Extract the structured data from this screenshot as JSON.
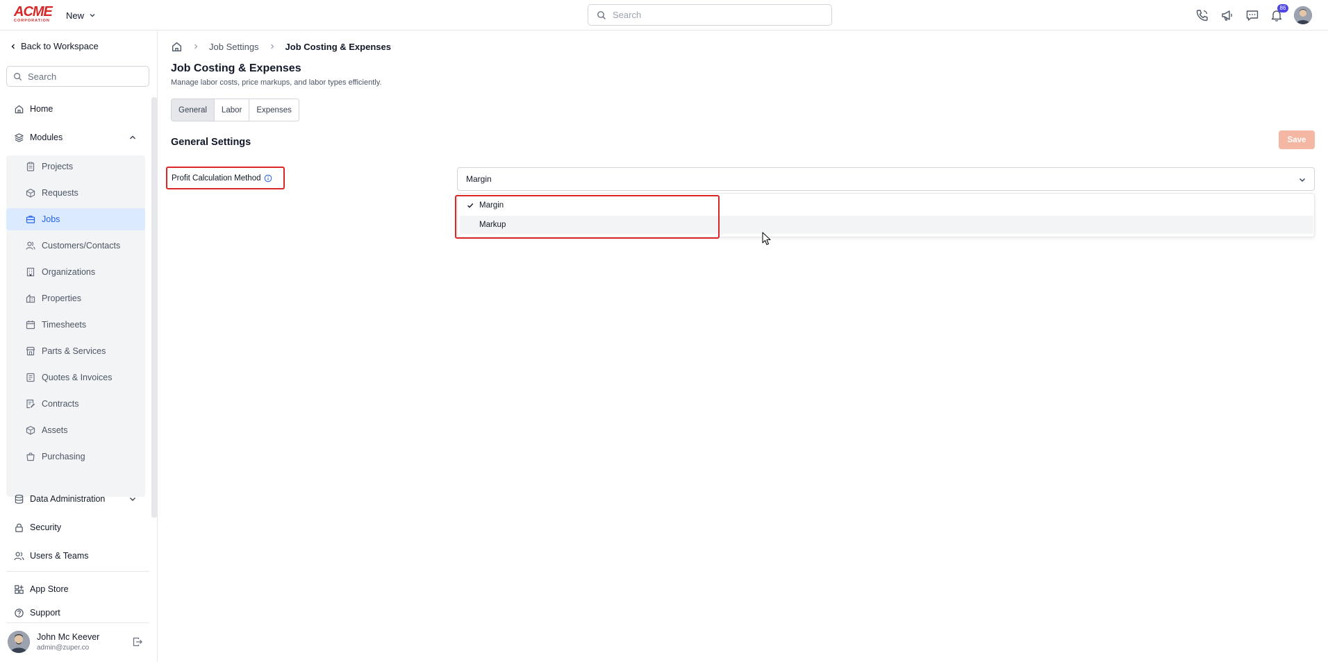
{
  "topbar": {
    "logo_text": "ACME",
    "logo_subtext": "CORPORATION",
    "new_label": "New",
    "search_placeholder": "Search",
    "notification_count": "86",
    "icons": [
      "phone-icon",
      "megaphone-icon",
      "chat-icon",
      "bell-icon"
    ]
  },
  "sidebar": {
    "back_label": "Back to Workspace",
    "search_placeholder": "Search",
    "home_label": "Home",
    "modules_label": "Modules",
    "modules": [
      {
        "label": "Projects",
        "icon": "clipboard-icon"
      },
      {
        "label": "Requests",
        "icon": "box-check-icon"
      },
      {
        "label": "Jobs",
        "icon": "briefcase-icon",
        "active": true
      },
      {
        "label": "Customers/Contacts",
        "icon": "users-icon"
      },
      {
        "label": "Organizations",
        "icon": "building-icon"
      },
      {
        "label": "Properties",
        "icon": "property-icon"
      },
      {
        "label": "Timesheets",
        "icon": "calendar-icon"
      },
      {
        "label": "Parts & Services",
        "icon": "store-icon"
      },
      {
        "label": "Quotes & Invoices",
        "icon": "invoice-icon"
      },
      {
        "label": "Contracts",
        "icon": "contract-icon"
      },
      {
        "label": "Assets",
        "icon": "cube-icon"
      },
      {
        "label": "Purchasing",
        "icon": "bag-icon"
      }
    ],
    "data_admin_label": "Data Administration",
    "security_label": "Security",
    "users_teams_label": "Users & Teams",
    "app_store_label": "App Store",
    "support_label": "Support",
    "user": {
      "name": "John Mc Keever",
      "email": "admin@zuper.co"
    }
  },
  "main": {
    "breadcrumb": [
      "Job Settings",
      "Job Costing & Expenses"
    ],
    "title": "Job Costing & Expenses",
    "subtitle": "Manage labor costs, price markups, and labor types efficiently.",
    "tabs": [
      {
        "label": "General",
        "active": true
      },
      {
        "label": "Labor"
      },
      {
        "label": "Expenses"
      }
    ],
    "section_title": "General Settings",
    "save_label": "Save",
    "field_label": "Profit Calculation Method",
    "select_value": "Margin",
    "options": [
      {
        "label": "Margin",
        "selected": true
      },
      {
        "label": "Markup",
        "hovered": true
      }
    ]
  },
  "colors": {
    "accent": "#2563eb",
    "highlight": "#dc2626",
    "save_disabled": "#f4b7a3",
    "active_bg": "#dbeafe"
  }
}
